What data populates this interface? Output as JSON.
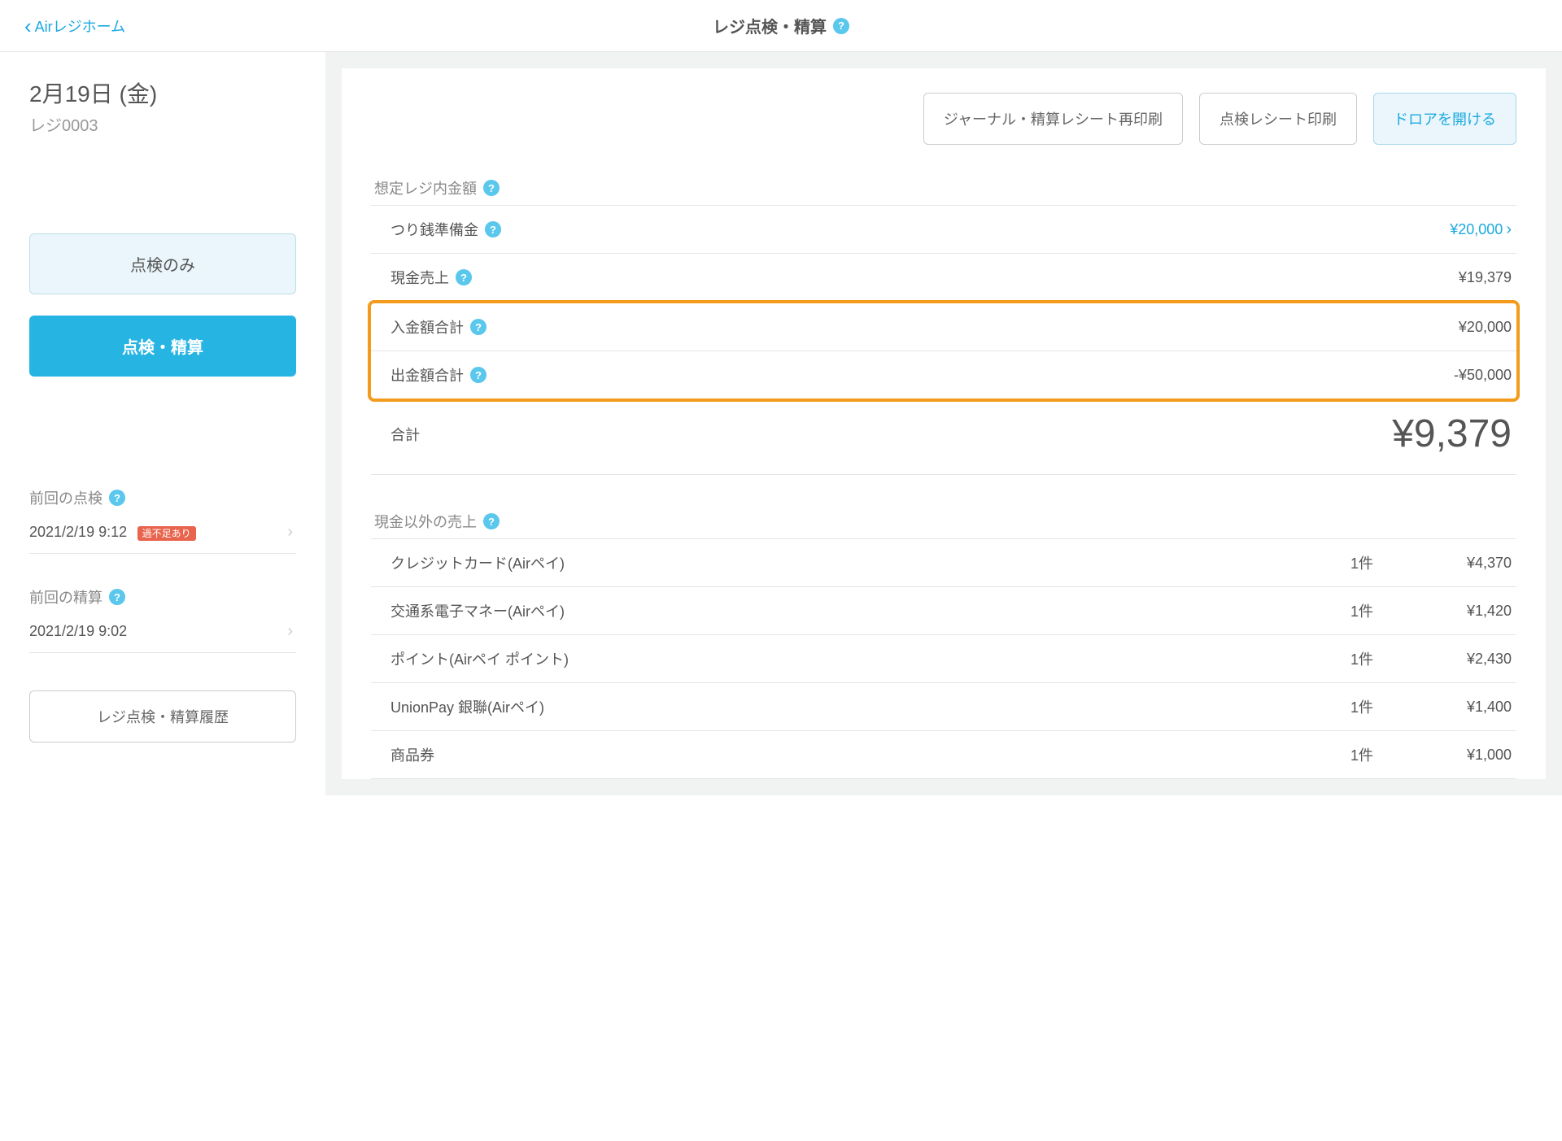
{
  "header": {
    "back_label": "Airレジホーム",
    "title": "レジ点検・精算"
  },
  "sidebar": {
    "date_text": "2月19日 (金)",
    "register_id": "レジ0003",
    "btn_inspect_only": "点検のみ",
    "btn_inspect_settle": "点検・精算",
    "prev_inspect_label": "前回の点検",
    "prev_inspect_time": "2021/2/19 9:12",
    "prev_inspect_badge": "過不足あり",
    "prev_settle_label": "前回の精算",
    "prev_settle_time": "2021/2/19 9:02",
    "history_btn": "レジ点検・精算履歴"
  },
  "toolbar": {
    "reprint": "ジャーナル・精算レシート再印刷",
    "print_inspect": "点検レシート印刷",
    "open_drawer": "ドロアを開ける"
  },
  "expected": {
    "section_label": "想定レジ内金額",
    "change_fund_label": "つり銭準備金",
    "change_fund_value": "¥20,000",
    "cash_sales_label": "現金売上",
    "cash_sales_value": "¥19,379",
    "deposit_label": "入金額合計",
    "deposit_value": "¥20,000",
    "withdraw_label": "出金額合計",
    "withdraw_value": "-¥50,000",
    "total_label": "合計",
    "total_value": "¥9,379"
  },
  "noncash": {
    "section_label": "現金以外の売上",
    "rows": [
      {
        "label": "クレジットカード(Airペイ)",
        "count": "1件",
        "value": "¥4,370"
      },
      {
        "label": "交通系電子マネー(Airペイ)",
        "count": "1件",
        "value": "¥1,420"
      },
      {
        "label": "ポイント(Airペイ ポイント)",
        "count": "1件",
        "value": "¥2,430"
      },
      {
        "label": "UnionPay 銀聯(Airペイ)",
        "count": "1件",
        "value": "¥1,400"
      },
      {
        "label": "商品券",
        "count": "1件",
        "value": "¥1,000"
      }
    ]
  }
}
